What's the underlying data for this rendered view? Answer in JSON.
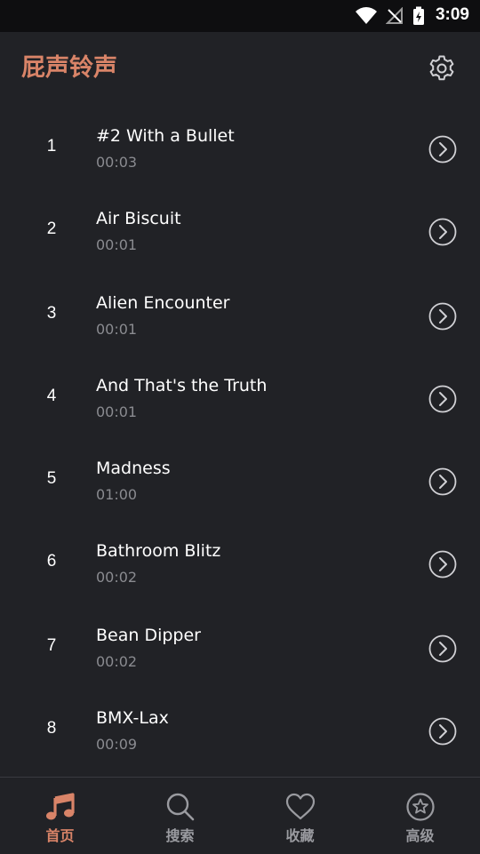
{
  "status_bar": {
    "time": "3:09"
  },
  "header": {
    "title": "屁声铃声"
  },
  "ringtones": [
    {
      "index": "1",
      "title": "#2 With a Bullet",
      "duration": "00:03"
    },
    {
      "index": "2",
      "title": "Air Biscuit",
      "duration": "00:01"
    },
    {
      "index": "3",
      "title": "Alien Encounter",
      "duration": "00:01"
    },
    {
      "index": "4",
      "title": "And That's the Truth",
      "duration": "00:01"
    },
    {
      "index": "5",
      "title": "Madness",
      "duration": "01:00"
    },
    {
      "index": "6",
      "title": "Bathroom Blitz",
      "duration": "00:02"
    },
    {
      "index": "7",
      "title": "Bean Dipper",
      "duration": "00:02"
    },
    {
      "index": "8",
      "title": "BMX-Lax",
      "duration": "00:09"
    }
  ],
  "bottom_nav": [
    {
      "label": "首页",
      "icon": "music-note-icon",
      "active": true
    },
    {
      "label": "搜索",
      "icon": "search-icon",
      "active": false
    },
    {
      "label": "收藏",
      "icon": "heart-icon",
      "active": false
    },
    {
      "label": "高级",
      "icon": "star-circle-icon",
      "active": false
    }
  ],
  "colors": {
    "accent": "#d98468",
    "background": "#212226",
    "muted": "#8a8b90"
  }
}
